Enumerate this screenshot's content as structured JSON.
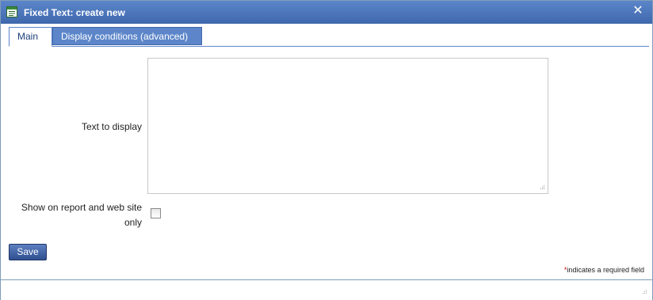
{
  "window": {
    "title": "Fixed Text: create new",
    "close_symbol": "✕"
  },
  "tabs": [
    {
      "label": "Main",
      "active": true
    },
    {
      "label": "Display conditions (advanced)",
      "active": false
    }
  ],
  "form": {
    "text_to_display_label": "Text to display",
    "text_to_display_value": "",
    "show_on_report_label": "Show on report and web site only",
    "show_on_report_checked": false
  },
  "actions": {
    "save_label": "Save"
  },
  "footer": {
    "required_star": "*",
    "required_note": "indicates a required field"
  },
  "colors": {
    "titlebar": "#4a73b8",
    "tab_active_text": "#1e3f7a",
    "tab_inactive_bg": "#5c86c9",
    "required_star": "#cc0000"
  }
}
